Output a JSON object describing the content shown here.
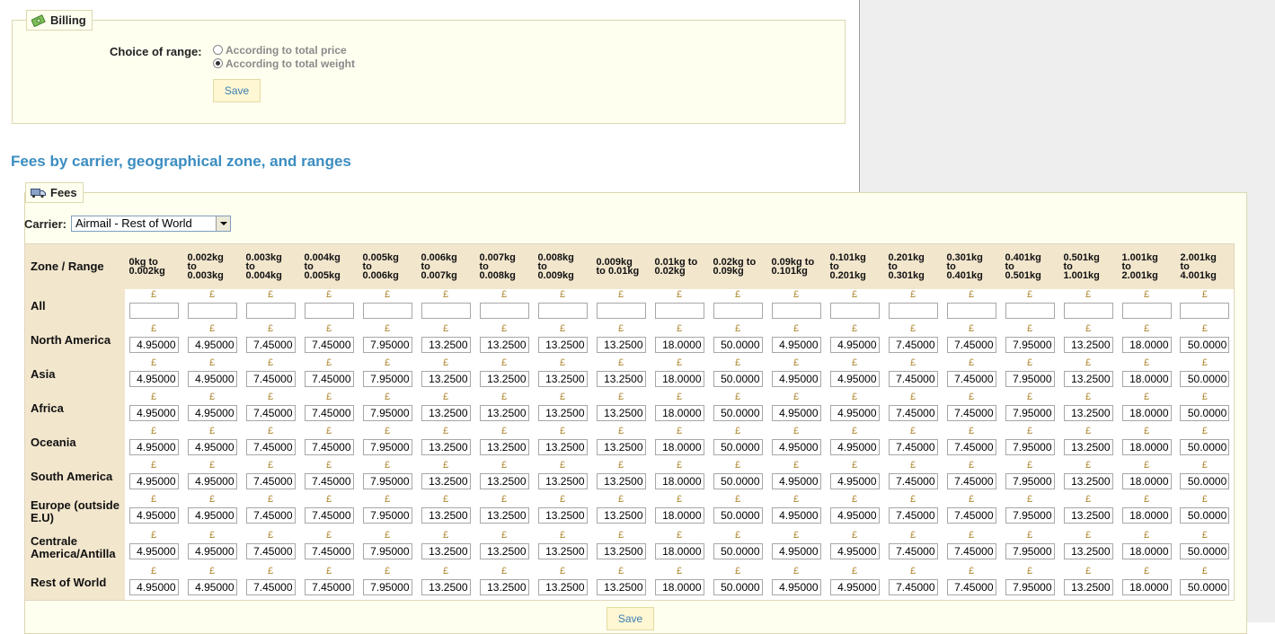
{
  "billing": {
    "legend": "Billing",
    "choice_label": "Choice of range:",
    "options": [
      "According to total price",
      "According to total weight"
    ],
    "selected_option": "According to total weight",
    "save_label": "Save"
  },
  "section_title": "Fees by carrier, geographical zone, and ranges",
  "fees": {
    "legend": "Fees",
    "carrier_label": "Carrier:",
    "carrier_value": "Airmail - Rest of World",
    "zone_header": "Zone / Range",
    "currency_symbol": "£",
    "ranges": [
      "0kg to\n0.002kg",
      "0.002kg\nto\n0.003kg",
      "0.003kg\nto\n0.004kg",
      "0.004kg\nto\n0.005kg",
      "0.005kg\nto\n0.006kg",
      "0.006kg\nto\n0.007kg",
      "0.007kg\nto\n0.008kg",
      "0.008kg\nto\n0.009kg",
      "0.009kg\nto 0.01kg",
      "0.01kg to\n0.02kg",
      "0.02kg to\n0.09kg",
      "0.09kg to\n0.101kg",
      "0.101kg\nto\n0.201kg",
      "0.201kg\nto\n0.301kg",
      "0.301kg\nto\n0.401kg",
      "0.401kg\nto\n0.501kg",
      "0.501kg\nto\n1.001kg",
      "1.001kg\nto\n2.001kg",
      "2.001kg\nto\n4.001kg"
    ],
    "zones": [
      {
        "name": "All",
        "values": [
          "",
          "",
          "",
          "",
          "",
          "",
          "",
          "",
          "",
          "",
          "",
          "",
          "",
          "",
          "",
          "",
          "",
          "",
          ""
        ]
      },
      {
        "name": "North America",
        "values": [
          "4.95000",
          "4.95000",
          "7.45000",
          "7.45000",
          "7.95000",
          "13.2500",
          "13.2500",
          "13.2500",
          "13.2500",
          "18.0000",
          "50.0000",
          "4.95000",
          "4.95000",
          "7.45000",
          "7.45000",
          "7.95000",
          "13.2500",
          "18.0000",
          "50.0000"
        ]
      },
      {
        "name": "Asia",
        "values": [
          "4.95000",
          "4.95000",
          "7.45000",
          "7.45000",
          "7.95000",
          "13.2500",
          "13.2500",
          "13.2500",
          "13.2500",
          "18.0000",
          "50.0000",
          "4.95000",
          "4.95000",
          "7.45000",
          "7.45000",
          "7.95000",
          "13.2500",
          "18.0000",
          "50.0000"
        ]
      },
      {
        "name": "Africa",
        "values": [
          "4.95000",
          "4.95000",
          "7.45000",
          "7.45000",
          "7.95000",
          "13.2500",
          "13.2500",
          "13.2500",
          "13.2500",
          "18.0000",
          "50.0000",
          "4.95000",
          "4.95000",
          "7.45000",
          "7.45000",
          "7.95000",
          "13.2500",
          "18.0000",
          "50.0000"
        ]
      },
      {
        "name": "Oceania",
        "values": [
          "4.95000",
          "4.95000",
          "7.45000",
          "7.45000",
          "7.95000",
          "13.2500",
          "13.2500",
          "13.2500",
          "13.2500",
          "18.0000",
          "50.0000",
          "4.95000",
          "4.95000",
          "7.45000",
          "7.45000",
          "7.95000",
          "13.2500",
          "18.0000",
          "50.0000"
        ]
      },
      {
        "name": "South America",
        "values": [
          "4.95000",
          "4.95000",
          "7.45000",
          "7.45000",
          "7.95000",
          "13.2500",
          "13.2500",
          "13.2500",
          "13.2500",
          "18.0000",
          "50.0000",
          "4.95000",
          "4.95000",
          "7.45000",
          "7.45000",
          "7.95000",
          "13.2500",
          "18.0000",
          "50.0000"
        ]
      },
      {
        "name": "Europe (outside E.U)",
        "values": [
          "4.95000",
          "4.95000",
          "7.45000",
          "7.45000",
          "7.95000",
          "13.2500",
          "13.2500",
          "13.2500",
          "13.2500",
          "18.0000",
          "50.0000",
          "4.95000",
          "4.95000",
          "7.45000",
          "7.45000",
          "7.95000",
          "13.2500",
          "18.0000",
          "50.0000"
        ]
      },
      {
        "name": "Centrale America/Antilla",
        "values": [
          "4.95000",
          "4.95000",
          "7.45000",
          "7.45000",
          "7.95000",
          "13.2500",
          "13.2500",
          "13.2500",
          "13.2500",
          "18.0000",
          "50.0000",
          "4.95000",
          "4.95000",
          "7.45000",
          "7.45000",
          "7.95000",
          "13.2500",
          "18.0000",
          "50.0000"
        ]
      },
      {
        "name": "Rest of World",
        "values": [
          "4.95000",
          "4.95000",
          "7.45000",
          "7.45000",
          "7.95000",
          "13.2500",
          "13.2500",
          "13.2500",
          "13.2500",
          "18.0000",
          "50.0000",
          "4.95000",
          "4.95000",
          "7.45000",
          "7.45000",
          "7.95000",
          "13.2500",
          "18.0000",
          "50.0000"
        ]
      }
    ],
    "save_label": "Save"
  },
  "icons": {
    "billing": "money-icon",
    "fees": "truck-icon"
  },
  "colors": {
    "panel_bg": "#fffff0",
    "header_bg": "#f2e6cd",
    "title_blue": "#3b8dc1",
    "currency": "#b08a34"
  }
}
